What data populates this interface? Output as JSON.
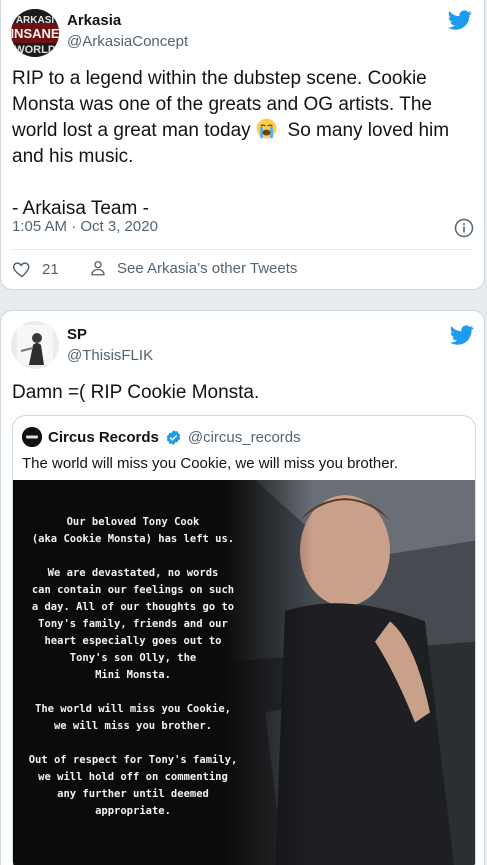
{
  "tweet1": {
    "display_name": "Arkasia",
    "handle": "@ArkasiaConcept",
    "avatar_text": "ARKASIA INSANE WORLD",
    "text_before_emoji": "RIP to a legend within the dubstep scene. Cookie Monsta was one of the greats and OG artists. The world lost a great man today ",
    "emoji": "loudly-crying-face",
    "text_after_emoji": "  So many loved him and his music.\n\n- Arkaisa Team -",
    "timestamp": "1:05 AM · Oct 3, 2020",
    "like_count": "21",
    "other_tweets_label": "See Arkasia’s other Tweets"
  },
  "tweet2": {
    "display_name": "SP",
    "handle": "@ThisisFLIK",
    "text": "Damn =( RIP Cookie Monsta.",
    "quote": {
      "display_name": "Circus Records",
      "handle": "@circus_records",
      "text": "The world will miss you Cookie, we will miss you brother.",
      "media_text": "Our beloved Tony Cook\n(aka Cookie Monsta) has left us.\n\nWe are devastated, no words\ncan contain our feelings on such\na day. All of our thoughts go to\nTony's family, friends and our\nheart especially goes out to\nTony's son Olly, the\nMini Monsta.\n\nThe world will miss you Cookie,\nwe will miss you brother.\n\nOut of respect for Tony's family,\nwe will hold off on commenting\nany further until deemed\nappropriate."
    }
  },
  "icons": {
    "brand": "twitter-bird-icon",
    "like": "heart-icon",
    "profile": "person-icon",
    "info": "info-icon",
    "verified": "verified-badge-icon"
  },
  "colors": {
    "twitter_blue": "#1d9bf0",
    "text_secondary": "#536471",
    "text_primary": "#0f1419"
  }
}
